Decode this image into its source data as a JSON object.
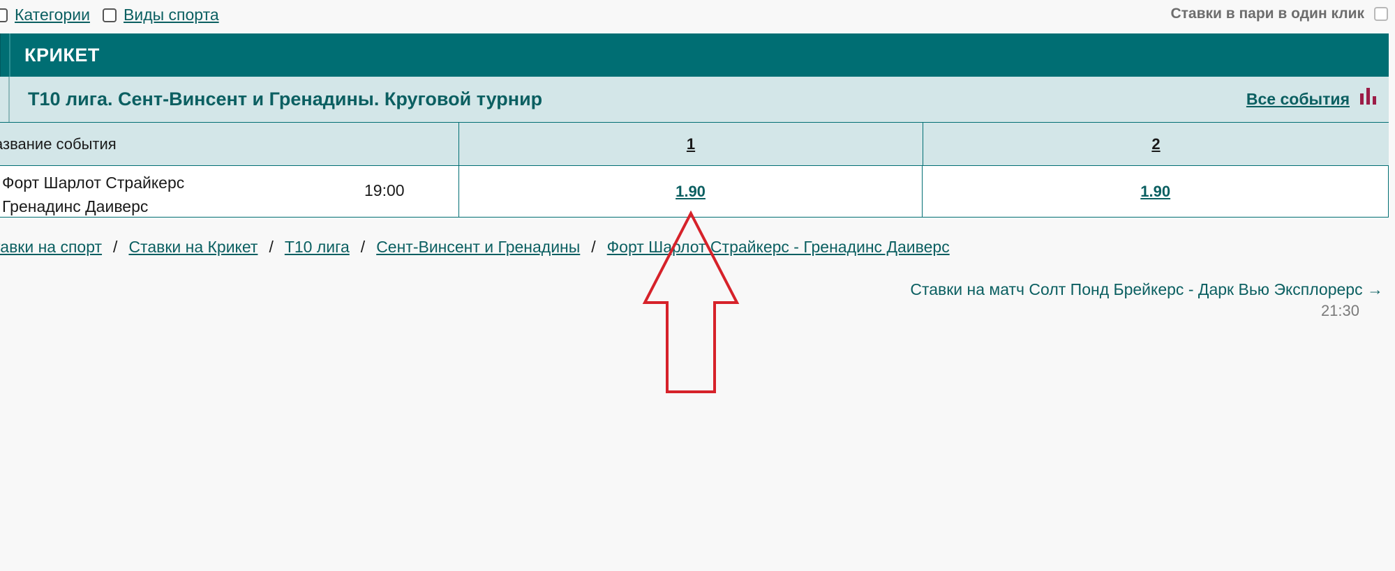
{
  "filters": {
    "categories_label": "Категории",
    "sports_label": "Виды спорта",
    "oneclick_label": "Ставки в пари в один клик"
  },
  "sport": {
    "title": "КРИКЕТ"
  },
  "league": {
    "title": "T10 лига. Сент-Винсент и Гренадины. Круговой турнир",
    "all_events_label": "Все события",
    "stats_icon": "bar-chart-icon"
  },
  "columns": {
    "name": "азвание события",
    "odd1": "1",
    "odd2": "2"
  },
  "event": {
    "team1": "Форт Шарлот Страйкерс",
    "team2": "Гренадинс Даиверс",
    "time": "19:00",
    "odd1": "1.90",
    "odd2": "1.90"
  },
  "breadcrumb": {
    "items": [
      "тавки на спорт",
      "Ставки на Крикет",
      "T10 лига",
      "Сент-Винсент и Гренадины",
      "Форт Шарлот Страйкерс - Гренадинс Даиверс"
    ],
    "separator": "/"
  },
  "next_match": {
    "label": "Ставки на матч Солт Понд Брейкерс - Дарк Вью Эксплорерс →",
    "time": "21:30"
  },
  "colors": {
    "header_bg": "#006e73",
    "subheader_bg": "#d3e6e8",
    "link": "#0b5f61",
    "annotation_arrow": "#d6222a",
    "stats_icon": "#9c1d47"
  }
}
